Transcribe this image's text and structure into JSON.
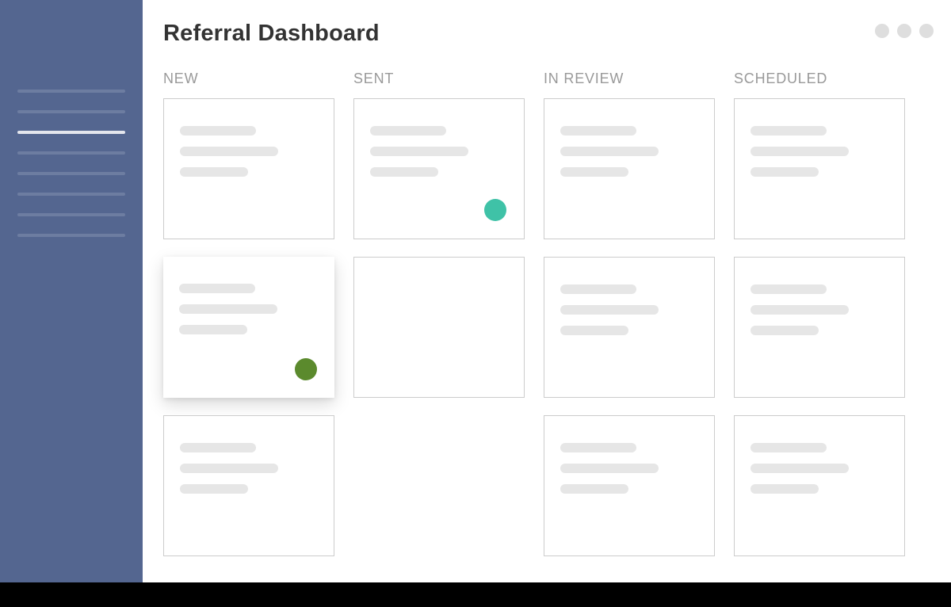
{
  "header": {
    "title": "Referral Dashboard"
  },
  "columns": [
    {
      "label": "NEW"
    },
    {
      "label": "SENT"
    },
    {
      "label": "IN REVIEW"
    },
    {
      "label": "SCHEDULED"
    }
  ],
  "status_colors": {
    "teal": "#3fc2a7",
    "green": "#5b8a2d"
  }
}
